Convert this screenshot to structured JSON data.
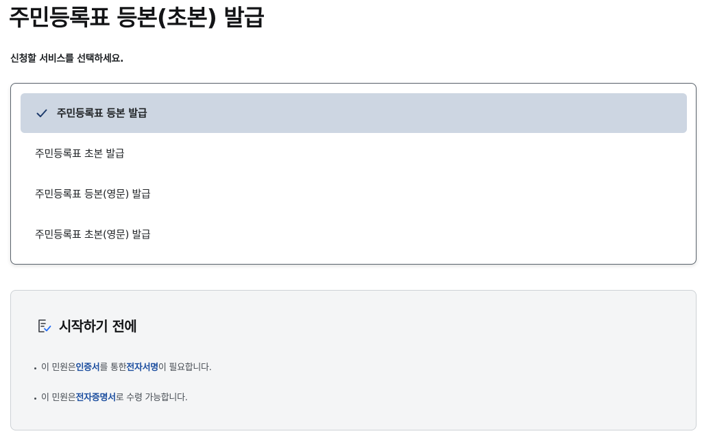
{
  "page": {
    "title": "주민등록표 등본(초본) 발급",
    "instruction": "신청할 서비스를 선택하세요."
  },
  "services": {
    "options": [
      {
        "label": "주민등록표 등본 발급",
        "selected": true
      },
      {
        "label": "주민등록표 초본 발급",
        "selected": false
      },
      {
        "label": "주민등록표 등본(영문) 발급",
        "selected": false
      },
      {
        "label": "주민등록표 초본(영문) 발급",
        "selected": false
      }
    ],
    "selected_icon": "check-icon"
  },
  "notice": {
    "icon": "document-check-icon",
    "title": "시작하기 전에",
    "items": [
      {
        "parts": [
          {
            "text": "이 민원은 ",
            "highlight": false
          },
          {
            "text": "인증서",
            "highlight": true
          },
          {
            "text": "를 통한 ",
            "highlight": false
          },
          {
            "text": "전자서명",
            "highlight": true
          },
          {
            "text": "이 필요합니다.",
            "highlight": false
          }
        ]
      },
      {
        "parts": [
          {
            "text": "이 민원은 ",
            "highlight": false
          },
          {
            "text": "전자증명서",
            "highlight": true
          },
          {
            "text": "로 수령 가능합니다.",
            "highlight": false
          }
        ]
      }
    ]
  },
  "colors": {
    "selected_background": "#cdd6e2",
    "highlight_text": "#1c4e9f",
    "check_icon": "#1c3a6b",
    "notice_background": "#f4f5f6"
  }
}
